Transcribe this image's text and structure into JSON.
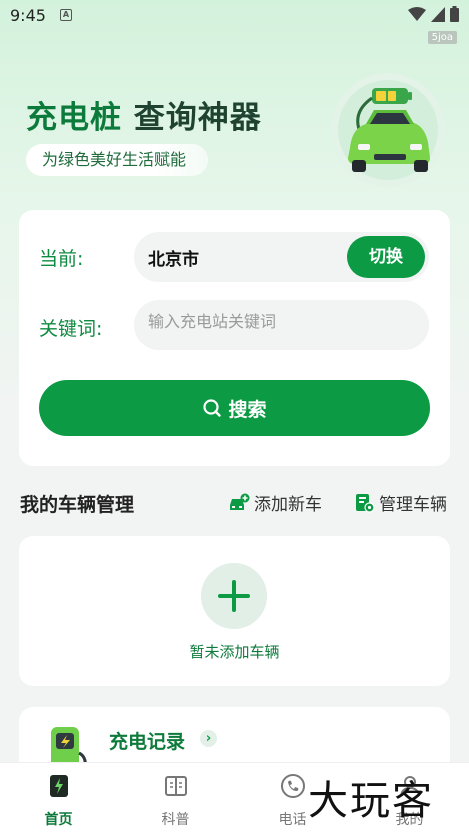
{
  "status": {
    "time": "9:45",
    "indicator": "A",
    "tag": "5joa"
  },
  "hero": {
    "title_green": "充电桩",
    "title_dark": "查询神器",
    "subtitle": "为绿色美好生活赋能"
  },
  "search": {
    "current_label": "当前:",
    "city": "北京市",
    "switch_label": "切换",
    "keyword_label": "关键词:",
    "keyword_placeholder": "输入充电站关键词",
    "keyword_value": "",
    "search_label": "搜索"
  },
  "vehicles": {
    "title": "我的车辆管理",
    "add_label": "添加新车",
    "manage_label": "管理车辆",
    "empty_label": "暂未添加车辆"
  },
  "records": {
    "title": "充电记录"
  },
  "tabs": [
    {
      "label": "首页",
      "icon": "home-charge-icon",
      "active": true
    },
    {
      "label": "科普",
      "icon": "book-icon",
      "active": false
    },
    {
      "label": "电话",
      "icon": "phone-icon",
      "active": false
    },
    {
      "label": "我的",
      "icon": "profile-icon",
      "active": false
    }
  ],
  "watermark": "大玩客",
  "colors": {
    "primary": "#0c9a44",
    "dark_green": "#0c7a3b",
    "background": "#f2f3f3"
  }
}
